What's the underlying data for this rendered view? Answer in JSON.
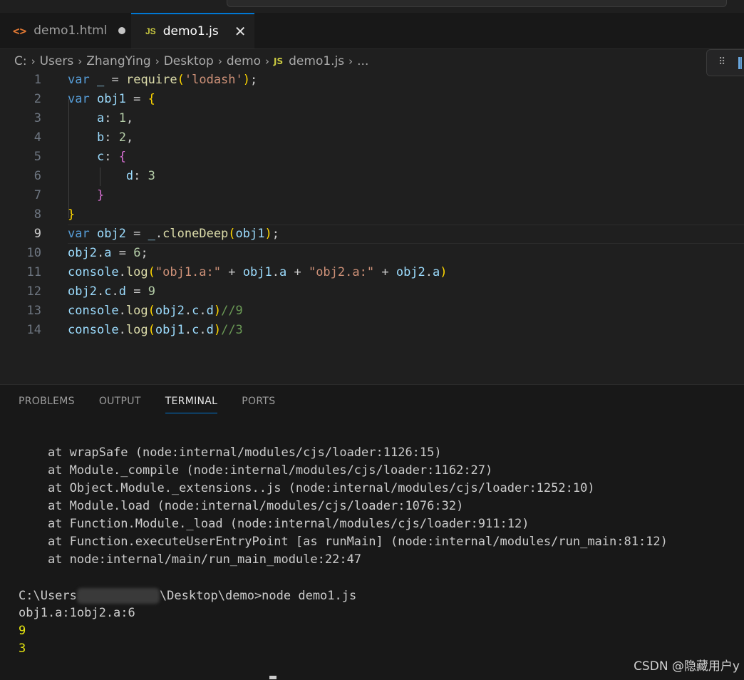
{
  "tabs": [
    {
      "icon": "html-icon",
      "label": "demo1.html",
      "dirty": true
    },
    {
      "icon": "js-icon",
      "label": "demo1.js",
      "active": true
    }
  ],
  "breadcrumb": [
    "C:",
    "Users",
    "ZhangYing",
    "Desktop",
    "demo",
    "demo1.js",
    "..."
  ],
  "breadcrumb_file_icon": "JS",
  "editor": {
    "line_numbers": [
      "1",
      "2",
      "3",
      "4",
      "5",
      "6",
      "7",
      "8",
      "9",
      "10",
      "11",
      "12",
      "13",
      "14"
    ],
    "current_line": "9"
  },
  "panel": {
    "tabs": [
      "PROBLEMS",
      "OUTPUT",
      "TERMINAL",
      "PORTS"
    ],
    "active_tab": "TERMINAL"
  },
  "terminal": {
    "stack": [
      "    at wrapSafe (node:internal/modules/cjs/loader:1126:15)",
      "    at Module._compile (node:internal/modules/cjs/loader:1162:27)",
      "    at Object.Module._extensions..js (node:internal/modules/cjs/loader:1252:10)",
      "    at Module.load (node:internal/modules/cjs/loader:1076:32)",
      "    at Function.Module._load (node:internal/modules/cjs/loader:911:12)",
      "    at Function.executeUserEntryPoint [as runMain] (node:internal/modules/run_main:81:12)",
      "    at node:internal/main/run_main_module:22:47"
    ],
    "prompt_prefix": "C:\\Users",
    "prompt_suffix": "\\Desktop\\demo>node demo1.js",
    "output": [
      "obj1.a:1obj2.a:6",
      "9",
      "3"
    ]
  },
  "watermark": "CSDN @隐藏用户y",
  "colors": {
    "accent": "#0078d4",
    "keyword": "#569cd6",
    "string": "#ce9178",
    "bracket": "#ffd700"
  }
}
